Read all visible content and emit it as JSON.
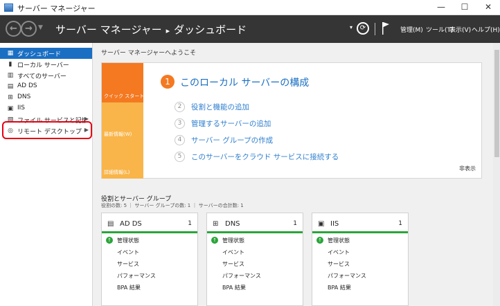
{
  "window": {
    "title": "サーバー マネージャー",
    "minimize": "—",
    "maximize": "☐",
    "close": "✕"
  },
  "nav": {
    "back": "←",
    "forward": "→",
    "crumb_root": "サーバー マネージャー",
    "crumb_sep": "▸",
    "crumb_current": "ダッシュボード",
    "menu_manage": "管理(M)",
    "menu_tools": "ツール(T)",
    "menu_view": "表示(V)",
    "menu_help": "ヘルプ(H)"
  },
  "sidebar": {
    "items": [
      {
        "label": "ダッシュボード",
        "icon": "dashboard-icon"
      },
      {
        "label": "ローカル サーバー",
        "icon": "server-icon"
      },
      {
        "label": "すべてのサーバー",
        "icon": "servers-icon"
      },
      {
        "label": "AD DS",
        "icon": "ad-ds-icon"
      },
      {
        "label": "DNS",
        "icon": "dns-icon"
      },
      {
        "label": "IIS",
        "icon": "iis-icon"
      },
      {
        "label": "ファイル サービスと記憶域サ...",
        "icon": "file-services-icon"
      },
      {
        "label": "リモート デスクトップ サービス",
        "icon": "remote-desktop-icon"
      }
    ]
  },
  "welcome": {
    "heading": "サーバー マネージャーへようこそ",
    "quick_start": "クイック スタート(Q)",
    "whats_new": "最新情報(W)",
    "learn_more": "詳細情報(L)",
    "main_step_num": "1",
    "main_step_label": "このローカル サーバーの構成",
    "steps": [
      {
        "num": "2",
        "label": "役割と機能の追加"
      },
      {
        "num": "3",
        "label": "管理するサーバーの追加"
      },
      {
        "num": "4",
        "label": "サーバー グループの作成"
      },
      {
        "num": "5",
        "label": "このサーバーをクラウド サービスに接続する"
      }
    ],
    "hide": "非表示"
  },
  "roles": {
    "title": "役割とサーバー グループ",
    "summary": "役割の数: 5 ｜ サーバー グループの数: 1 ｜ サーバーの合計数: 1",
    "cards": [
      {
        "title": "AD DS",
        "count": "1",
        "icon": "ad-ds-icon",
        "rows": [
          "管理状態",
          "イベント",
          "サービス",
          "パフォーマンス",
          "BPA 結果"
        ]
      },
      {
        "title": "DNS",
        "count": "1",
        "icon": "dns-icon",
        "rows": [
          "管理状態",
          "イベント",
          "サービス",
          "パフォーマンス",
          "BPA 結果"
        ]
      },
      {
        "title": "IIS",
        "count": "1",
        "icon": "iis-icon",
        "rows": [
          "管理状態",
          "イベント",
          "サービス",
          "パフォーマンス",
          "BPA 結果"
        ]
      }
    ]
  },
  "colors": {
    "accent": "#1a6fc3",
    "quick_start": "#f47920",
    "tile": "#f9b54a",
    "ok": "#2aa539",
    "highlight": "#e60012"
  }
}
